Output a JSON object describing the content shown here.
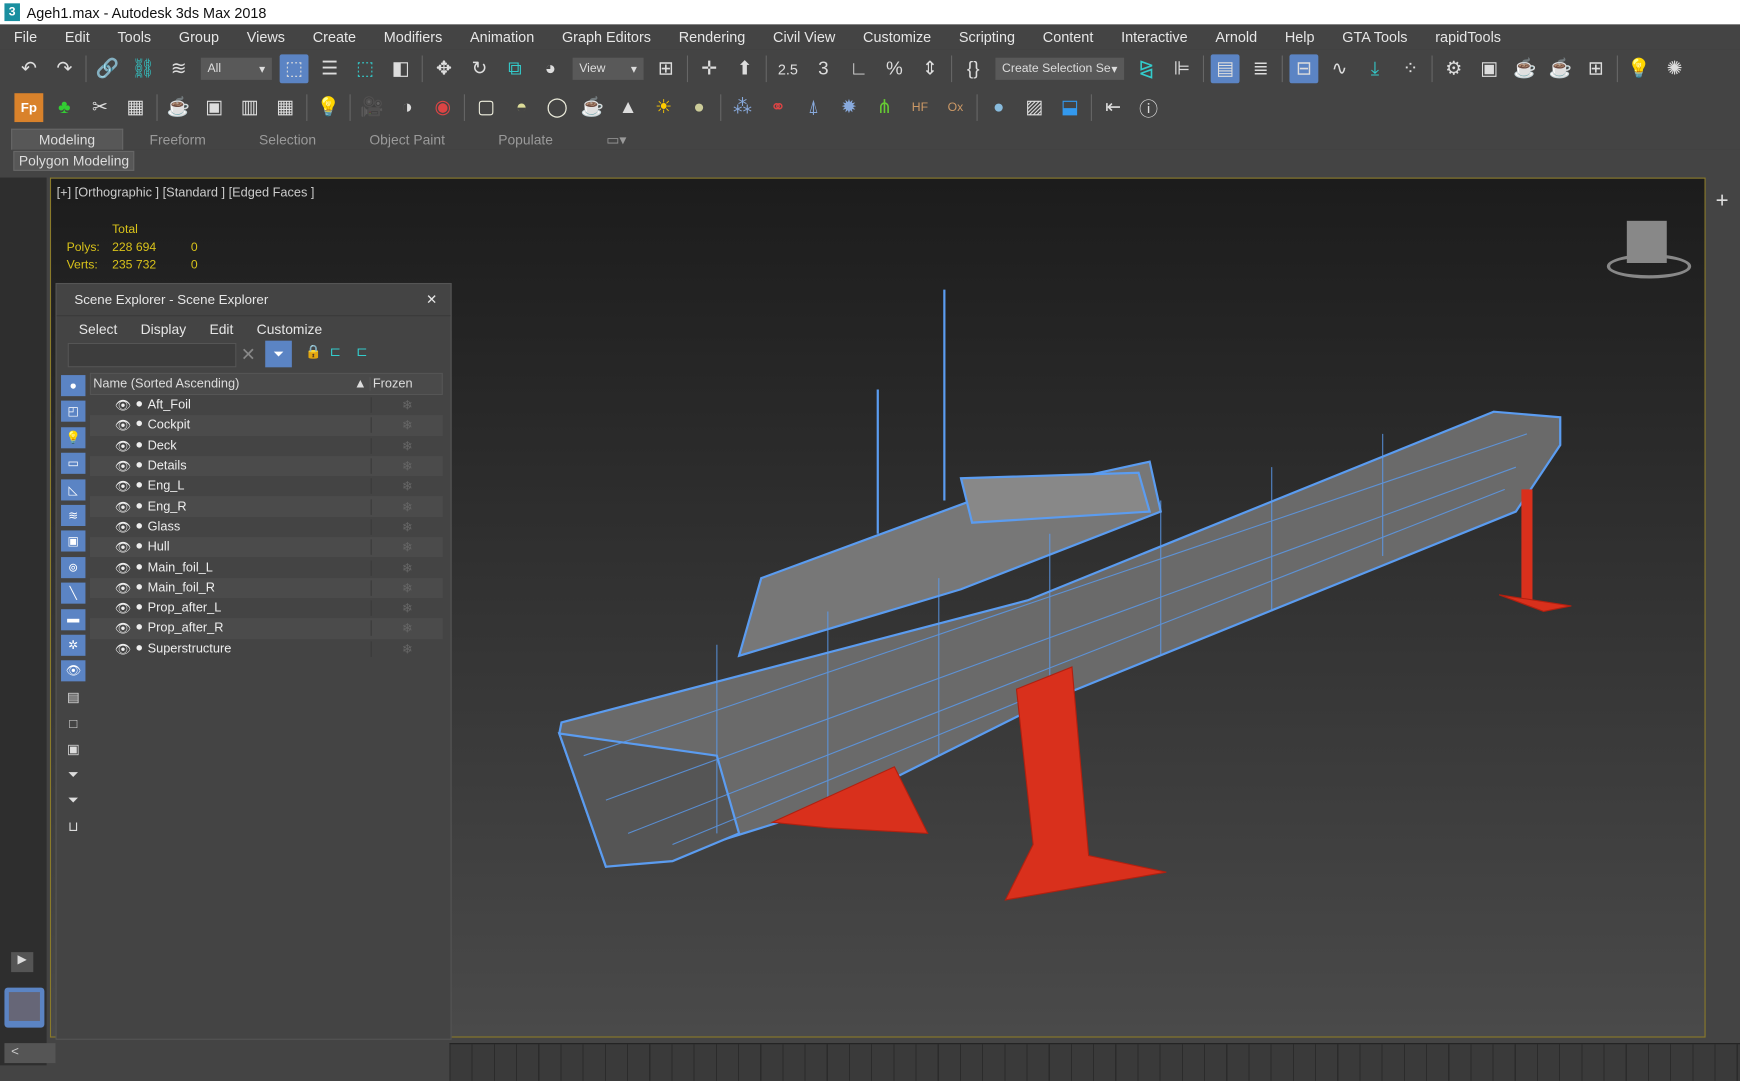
{
  "window": {
    "title": "Ageh1.max - Autodesk 3ds Max 2018",
    "logo": "3"
  },
  "menu": [
    "File",
    "Edit",
    "Tools",
    "Group",
    "Views",
    "Create",
    "Modifiers",
    "Animation",
    "Graph Editors",
    "Rendering",
    "Civil View",
    "Customize",
    "Scripting",
    "Content",
    "Interactive",
    "Arnold",
    "Help",
    "GTA Tools",
    "rapidTools"
  ],
  "toolbar": {
    "selection_filter": "All",
    "ref_coord": "View",
    "named_selection": "Create Selection Se",
    "snap_25": "2.5",
    "snap_3": "3"
  },
  "ribbon": {
    "tabs": [
      "Modeling",
      "Freeform",
      "Selection",
      "Object Paint",
      "Populate"
    ],
    "active": "Modeling",
    "panel": "Polygon Modeling"
  },
  "viewport": {
    "label": "[+] [Orthographic ] [Standard ] [Edged Faces ]",
    "stats": {
      "header": "Total",
      "polys_label": "Polys:",
      "polys": "228 694",
      "polys_sel": "0",
      "verts_label": "Verts:",
      "verts": "235 732",
      "verts_sel": "0"
    },
    "wire_color": "#5b9cf0",
    "foil_color": "#d9301c",
    "border_color": "#8a7a2a"
  },
  "scene_explorer": {
    "title": "Scene Explorer - Scene Explorer",
    "close": "✕",
    "menu": [
      "Select",
      "Display",
      "Edit",
      "Customize"
    ],
    "search_value": "",
    "col_name": "Name (Sorted Ascending)",
    "sort_arrow": "▲",
    "col_frozen": "Frozen",
    "objects": [
      "Aft_Foil",
      "Cockpit",
      "Deck",
      "Details",
      "Eng_L",
      "Eng_R",
      "Glass",
      "Hull",
      "Main_foil_L",
      "Main_foil_R",
      "Prop_after_L",
      "Prop_after_R",
      "Superstructure"
    ]
  },
  "right_panel": {
    "create_icon": "+"
  }
}
